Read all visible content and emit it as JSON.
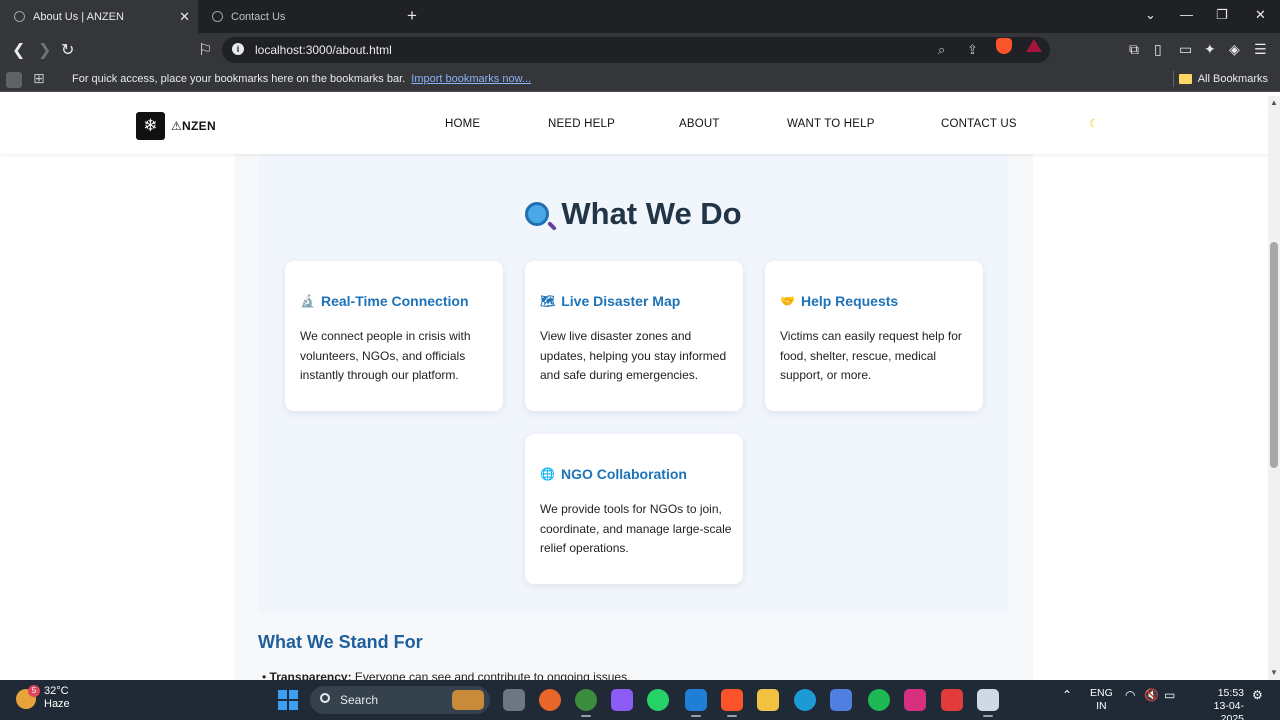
{
  "browser": {
    "tabs": [
      {
        "title": "About Us | ANZEN",
        "active": true
      },
      {
        "title": "Contact Us",
        "active": false
      }
    ],
    "url": "localhost:3000/about.html",
    "bookmarks_bar": {
      "hint": "For quick access, place your bookmarks here on the bookmarks bar.",
      "import_link": "Import bookmarks now...",
      "all_bookmarks": "All Bookmarks"
    }
  },
  "site": {
    "brand": "⚠NZEN",
    "nav": [
      "HOME",
      "NEED HELP",
      "ABOUT",
      "WANT TO HELP",
      "CONTACT US"
    ],
    "theme_toggle_icon": "moon-icon"
  },
  "what_we_do": {
    "title": "What We Do",
    "cards": [
      {
        "icon": "microscope-icon",
        "glyph": "🔬",
        "title": "Real-Time Connection",
        "text": "We connect people in crisis with volunteers, NGOs, and officials instantly through our platform."
      },
      {
        "icon": "world-map-icon",
        "glyph": "🗺",
        "title": "Live Disaster Map",
        "text": "View live disaster zones and updates, helping you stay informed and safe during emergencies."
      },
      {
        "icon": "handshake-icon",
        "glyph": "🤝",
        "title": "Help Requests",
        "text": "Victims can easily request help for food, shelter, rescue, medical support, or more."
      },
      {
        "icon": "globe-icon",
        "glyph": "🌐",
        "title": "NGO Collaboration",
        "text": "We provide tools for NGOs to join, coordinate, and manage large-scale relief operations."
      }
    ]
  },
  "what_we_stand_for": {
    "title": "What We Stand For",
    "items": [
      {
        "label": "Transparency:",
        "text": " Everyone can see and contribute to ongoing issues."
      }
    ]
  },
  "taskbar": {
    "weather": {
      "temp": "32°C",
      "condition": "Haze",
      "badge": "5"
    },
    "search_placeholder": "Search",
    "lang": "ENG",
    "region": "IN",
    "time": "15:53",
    "date": "13-04-2025"
  },
  "colors": {
    "accent_blue": "#1e73b8",
    "heading_dark": "#213547",
    "section_bg": "#f1f5fc"
  }
}
